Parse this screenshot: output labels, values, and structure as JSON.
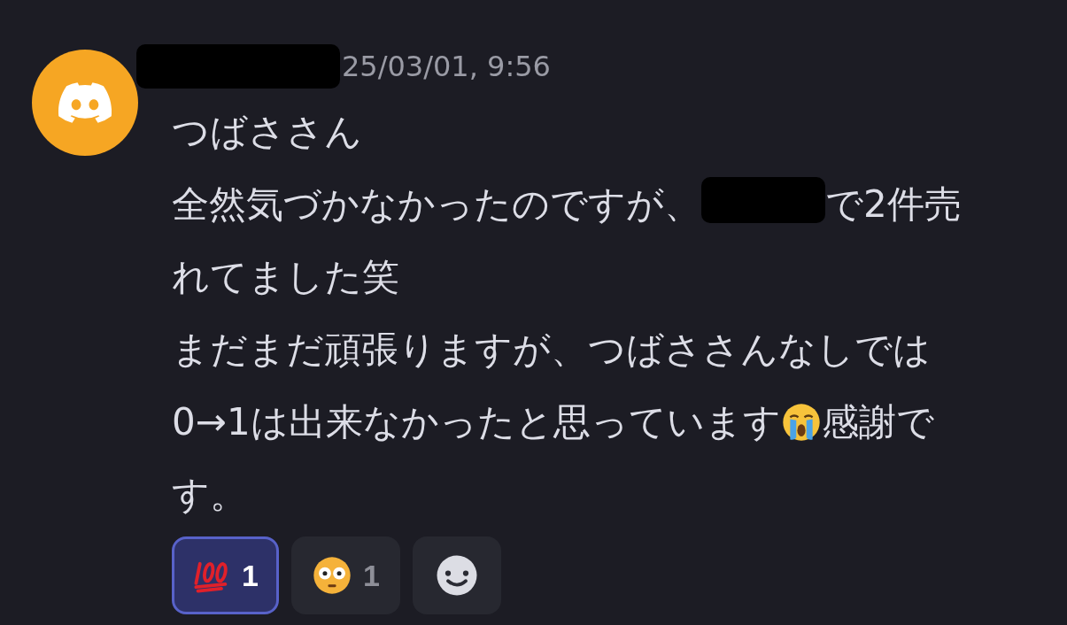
{
  "message": {
    "timestamp": "25/03/01, 9:56",
    "paragraphs": [
      {
        "lines": [
          [
            {
              "kind": "text",
              "text": "つばささん"
            }
          ]
        ]
      },
      {
        "lines": [
          [
            {
              "kind": "text",
              "text": "全然気づかなかったのですが、"
            },
            {
              "kind": "redaction"
            },
            {
              "kind": "text",
              "text": "で2件売"
            }
          ],
          [
            {
              "kind": "text",
              "text": "れてました笑"
            }
          ]
        ]
      },
      {
        "lines": [
          [
            {
              "kind": "text",
              "text": "まだまだ頑張りますが、つばささんなしでは"
            }
          ],
          [
            {
              "kind": "text",
              "text": "0→1は出来なかったと思っています"
            },
            {
              "kind": "emoji"
            },
            {
              "kind": "text",
              "text": "感謝で"
            }
          ],
          [
            {
              "kind": "text",
              "text": "す。"
            }
          ]
        ]
      }
    ],
    "reactions": [
      {
        "kind": "hundred",
        "count": "1",
        "selected": true
      },
      {
        "kind": "flushed",
        "count": "1",
        "selected": false
      }
    ]
  }
}
